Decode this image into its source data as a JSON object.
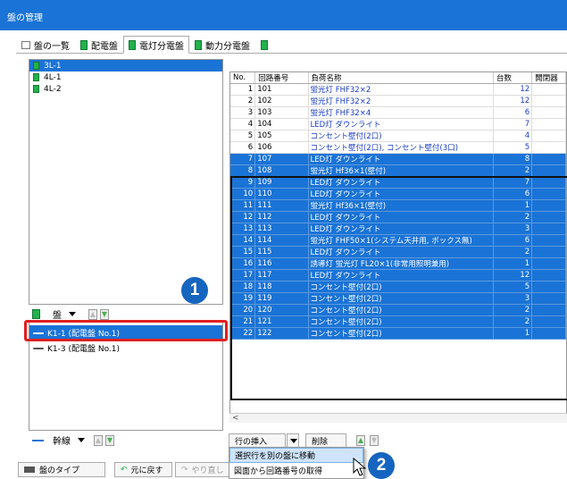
{
  "window": {
    "title": "盤の管理"
  },
  "tabs": [
    {
      "label": "盤の一覧",
      "icon": "list-icon"
    },
    {
      "label": "配電盤",
      "icon": "panel-green-icon"
    },
    {
      "label": "電灯分電盤",
      "icon": "panel-green-icon",
      "active": true
    },
    {
      "label": "動力分電盤",
      "icon": "panel-green-icon"
    }
  ],
  "tree": {
    "items": [
      {
        "label": "3L-1",
        "selected": true
      },
      {
        "label": "4L-1",
        "selected": false
      },
      {
        "label": "4L-2",
        "selected": false
      }
    ],
    "toolbar": {
      "label": "盤"
    }
  },
  "feeders": {
    "items": [
      {
        "label": "K1-1 (配電盤 No.1)",
        "selected": true
      },
      {
        "label": "K1-3 (配電盤 No.1)",
        "selected": false
      }
    ],
    "toolbar": {
      "label": "幹線"
    }
  },
  "badges": {
    "one": "1",
    "two": "2"
  },
  "grid": {
    "headers": [
      "No.",
      "回路番号",
      "負荷名称",
      "台数",
      "開閉器"
    ],
    "rows": [
      {
        "no": "1",
        "circuit": "101",
        "name": "蛍光灯 FHF32×2",
        "count": "12",
        "sel": false
      },
      {
        "no": "2",
        "circuit": "102",
        "name": "蛍光灯 FHF32×2",
        "count": "12",
        "sel": false
      },
      {
        "no": "3",
        "circuit": "103",
        "name": "蛍光灯 FHF32×4",
        "count": "6",
        "sel": false
      },
      {
        "no": "4",
        "circuit": "104",
        "name": "LED灯 ダウンライト",
        "count": "7",
        "sel": false
      },
      {
        "no": "5",
        "circuit": "105",
        "name": "コンセント壁付(2口)",
        "count": "4",
        "sel": false
      },
      {
        "no": "6",
        "circuit": "106",
        "name": "コンセント壁付(2口), コンセント壁付(3口)",
        "count": "5",
        "sel": false
      },
      {
        "no": "7",
        "circuit": "107",
        "name": "LED灯 ダウンライト",
        "count": "8",
        "sel": true
      },
      {
        "no": "8",
        "circuit": "108",
        "name": "蛍光灯 Hf36×1(壁付)",
        "count": "2",
        "sel": true
      },
      {
        "no": "9",
        "circuit": "109",
        "name": "LED灯 ダウンライト",
        "count": "7",
        "sel": true
      },
      {
        "no": "10",
        "circuit": "110",
        "name": "LED灯 ダウンライト",
        "count": "6",
        "sel": true
      },
      {
        "no": "11",
        "circuit": "111",
        "name": "蛍光灯 Hf36×1(壁付)",
        "count": "1",
        "sel": true
      },
      {
        "no": "12",
        "circuit": "112",
        "name": "LED灯 ダウンライト",
        "count": "2",
        "sel": true
      },
      {
        "no": "13",
        "circuit": "113",
        "name": "LED灯 ダウンライト",
        "count": "3",
        "sel": true
      },
      {
        "no": "14",
        "circuit": "114",
        "name": "蛍光灯 FHF50×1(システム天井用, ボックス無)",
        "count": "6",
        "sel": true
      },
      {
        "no": "15",
        "circuit": "115",
        "name": "LED灯 ダウンライト",
        "count": "2",
        "sel": true
      },
      {
        "no": "16",
        "circuit": "116",
        "name": "誘導灯 蛍光灯 FL20×1(非常用照明兼用)",
        "count": "1",
        "sel": true
      },
      {
        "no": "17",
        "circuit": "117",
        "name": "LED灯 ダウンライト",
        "count": "12",
        "sel": true
      },
      {
        "no": "18",
        "circuit": "118",
        "name": "コンセント壁付(2口)",
        "count": "5",
        "sel": true
      },
      {
        "no": "19",
        "circuit": "119",
        "name": "コンセント壁付(2口)",
        "count": "3",
        "sel": true
      },
      {
        "no": "20",
        "circuit": "120",
        "name": "コンセント壁付(2口)",
        "count": "2",
        "sel": true
      },
      {
        "no": "21",
        "circuit": "121",
        "name": "コンセント壁付(2口)",
        "count": "2",
        "sel": true
      },
      {
        "no": "22",
        "circuit": "122",
        "name": "コンセント壁付(2口)",
        "count": "1",
        "sel": true
      }
    ]
  },
  "buttons": {
    "insert_row": "行の挿入",
    "delete": "削除",
    "panel_type": "盤のタイプ",
    "undo": "元に戻す",
    "redo": "やり直し"
  },
  "context_menu": {
    "items": [
      "選択行を別の盤に移動",
      "図面から回路番号の取得"
    ]
  },
  "colors": {
    "accent": "#1a73d6",
    "highlight": "#e02020",
    "badge": "#1565c0"
  }
}
